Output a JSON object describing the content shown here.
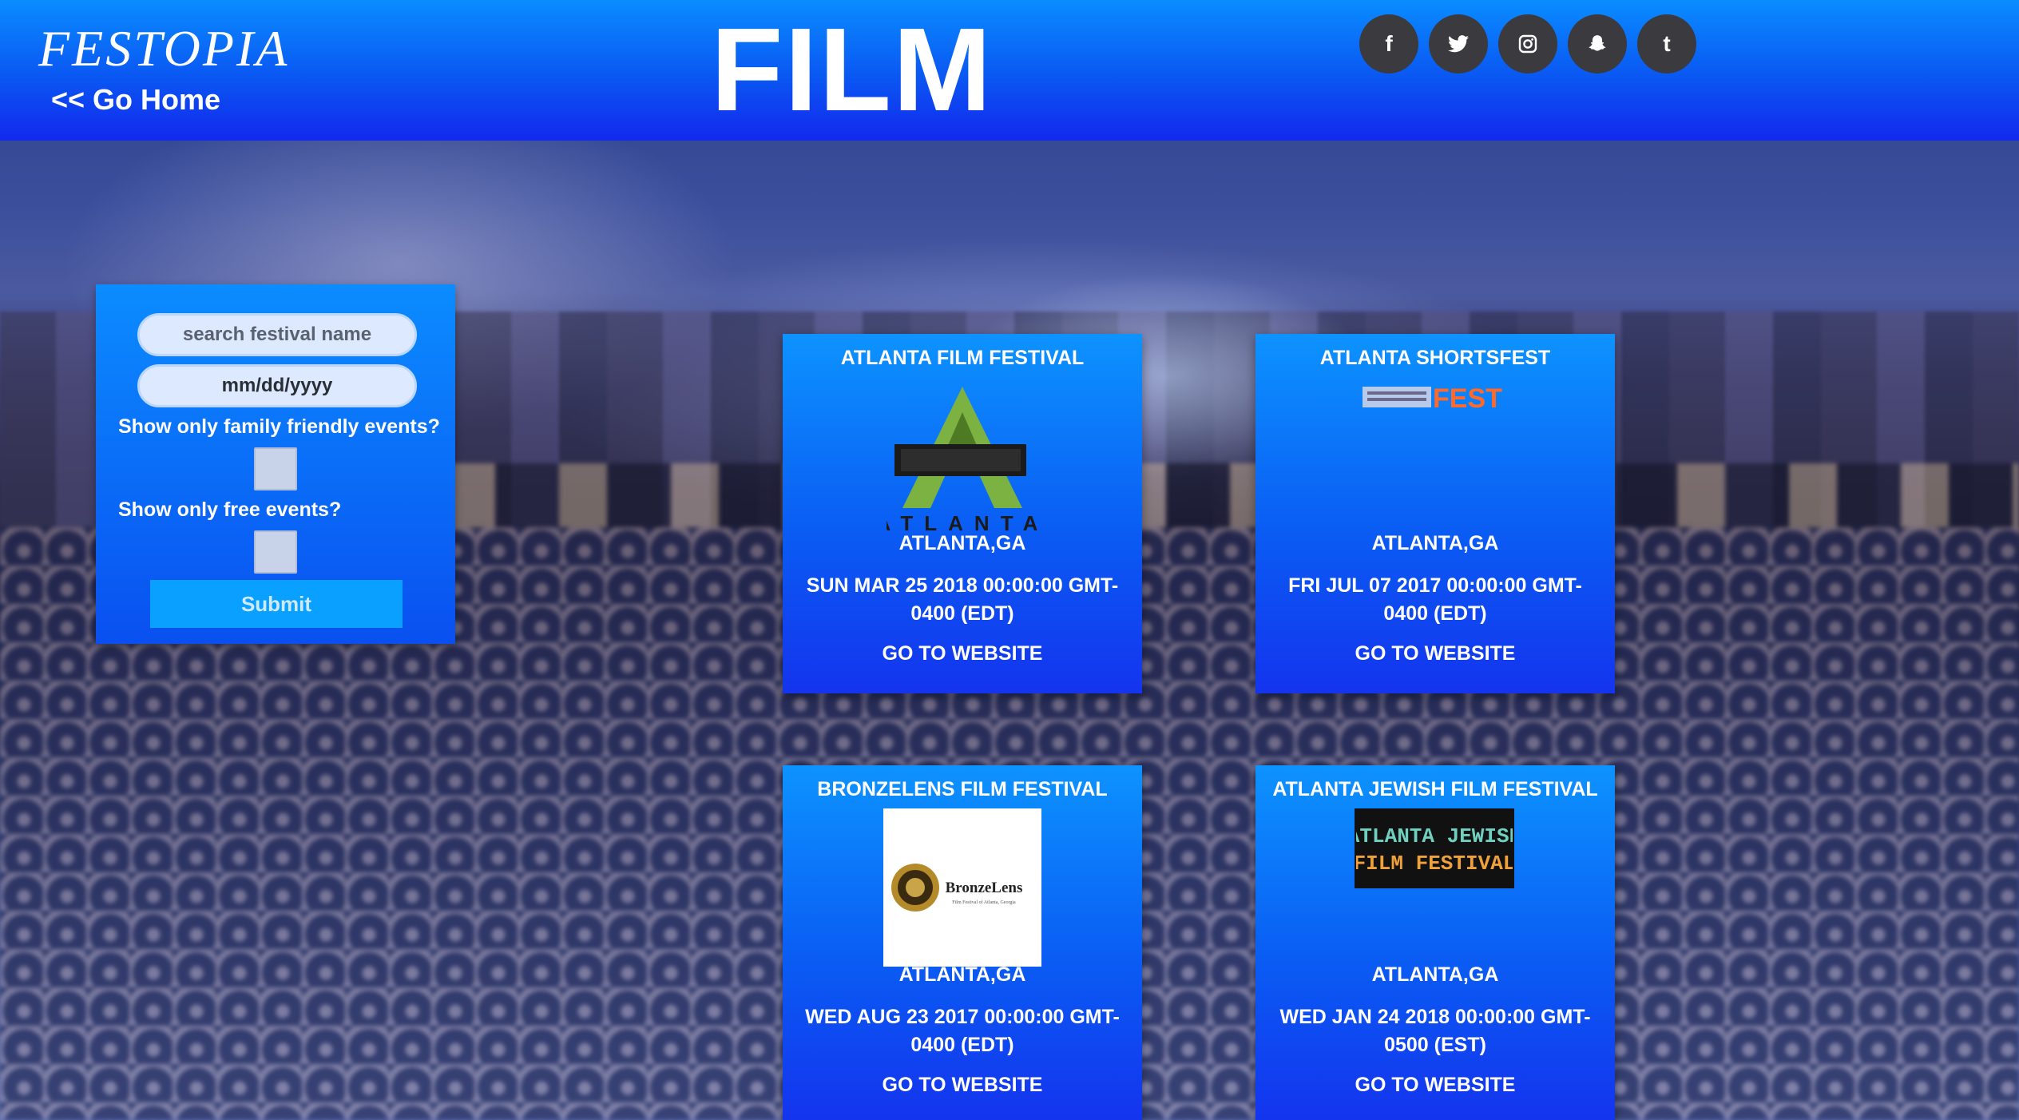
{
  "header": {
    "logo": "FESTOPIA",
    "go_home": "<< Go Home",
    "title": "FILM",
    "socials": [
      {
        "icon": "facebook-icon",
        "glyph": "f"
      },
      {
        "icon": "twitter-icon",
        "glyph": "t"
      },
      {
        "icon": "instagram-icon",
        "glyph": ""
      },
      {
        "icon": "snapchat-icon",
        "glyph": ""
      },
      {
        "icon": "tumblr-icon",
        "glyph": "t"
      }
    ]
  },
  "filters": {
    "search_placeholder": "search festival name",
    "date_placeholder": "mm/dd/yyyy",
    "family_label": "Show only family friendly events?",
    "free_label": "Show only free events?",
    "submit_label": "Submit"
  },
  "festivals": [
    {
      "name": "ATLANTA FILM FESTIVAL",
      "image": "atlanta-film-festival-logo",
      "logo_text": "ATLANTA",
      "location": "ATLANTA,GA",
      "date": "SUN MAR 25 2018 00:00:00 GMT-0400 (EDT)",
      "link": "GO TO WEBSITE"
    },
    {
      "name": "ATLANTA SHORTSFEST",
      "image": "shortsfest-logo",
      "logo_text": "FEST",
      "location": "ATLANTA,GA",
      "date": "FRI JUL 07 2017 00:00:00 GMT-0400 (EDT)",
      "link": "GO TO WEBSITE"
    },
    {
      "name": "BRONZELENS FILM FESTIVAL",
      "image": "bronzelens-logo",
      "logo_text": "BronzeLens",
      "logo_subtext": "Film Festival of Atlanta, Georgia",
      "location": "ATLANTA,GA",
      "date": "WED AUG 23 2017 00:00:00 GMT-0400 (EDT)",
      "link": "GO TO WEBSITE"
    },
    {
      "name": "ATLANTA JEWISH FILM FESTIVAL",
      "image": "atlanta-jewish-film-festival-logo",
      "logo_line1": "ATLANTA JEWISH",
      "logo_line2": "FILM FESTIVAL",
      "location": "ATLANTA,GA",
      "date": "WED JAN 24 2018 00:00:00 GMT-0500 (EST)",
      "link": "GO TO WEBSITE"
    }
  ],
  "colors": {
    "header_top": "#0a8cff",
    "header_bottom": "#1328ee",
    "card_top": "#0d93ff",
    "card_bottom": "#1434ee",
    "social_bg": "#3a3a3f",
    "submit_bg": "#0aa0ff"
  }
}
